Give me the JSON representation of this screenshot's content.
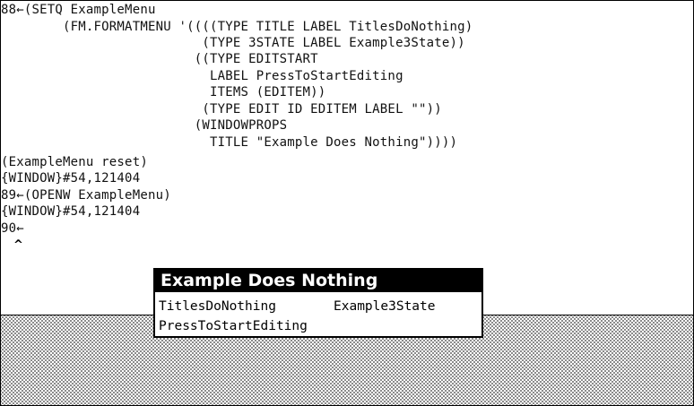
{
  "exec": {
    "lines": [
      "88←(SETQ ExampleMenu",
      "        (FM.FORMATMENU '((((TYPE TITLE LABEL TitlesDoNothing)",
      "                          (TYPE 3STATE LABEL Example3State))",
      "                         ((TYPE EDITSTART",
      "                           LABEL PressToStartEditing",
      "                           ITEMS (EDITEM))",
      "                          (TYPE EDIT ID EDITEM LABEL \"\"))",
      "                         (WINDOWPROPS",
      "                           TITLE \"Example Does Nothing\"))))",
      "(ExampleMenu reset)",
      "{WINDOW}#54,121404",
      "89←(OPENW ExampleMenu)",
      "{WINDOW}#54,121404",
      "90←"
    ],
    "caret": "^"
  },
  "menu": {
    "title": "Example Does Nothing",
    "items": {
      "titles": "TitlesDoNothing",
      "three_state": "Example3State",
      "edit_start": "PressToStartEditing"
    }
  },
  "colors": {
    "title_bar": "#000000",
    "title_text": "#ffffff",
    "background_pattern": "#6e6e6e"
  }
}
